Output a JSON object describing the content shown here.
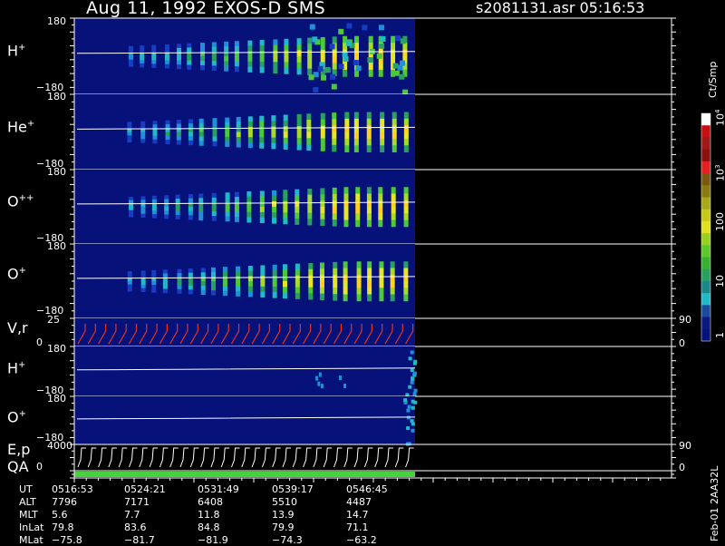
{
  "header": {
    "title": "Aug 11, 1992    EXOS-D SMS",
    "file_info": "s2081131.asr  05:16:53"
  },
  "panels": [
    {
      "label": "H",
      "sup": "+",
      "top": "180",
      "bottom": "−180"
    },
    {
      "label": "He",
      "sup": "+",
      "top": "180",
      "bottom": "−180"
    },
    {
      "label": "O",
      "sup": "++",
      "top": "180",
      "bottom": "−180"
    },
    {
      "label": "O",
      "sup": "+",
      "top": "180",
      "bottom": "−180"
    },
    {
      "label": "V,r",
      "sup": "",
      "top": "25",
      "bottom": "0",
      "right_top": "90",
      "right_bottom": "0"
    },
    {
      "label": "H",
      "sup": "+",
      "top": "180",
      "bottom": "−180"
    },
    {
      "label": "O",
      "sup": "+",
      "top": "180",
      "bottom": "−180"
    },
    {
      "label": "E,p",
      "sup": "",
      "top": "4000",
      "bottom": "0",
      "right_top": "90",
      "right_bottom": "0"
    },
    {
      "label": "QA",
      "sup": "",
      "top": "",
      "bottom": ""
    }
  ],
  "colorbar": {
    "units": "Ct/Smp",
    "labels": [
      {
        "text": "10",
        "sup": "4"
      },
      {
        "text": "10",
        "sup": "3"
      },
      {
        "text": "100",
        "sup": ""
      },
      {
        "text": "10",
        "sup": ""
      },
      {
        "text": "1",
        "sup": ""
      }
    ]
  },
  "orbit": {
    "rows": [
      {
        "name": "UT",
        "values": [
          "0516:53",
          "0524:21",
          "0531:49",
          "0539:17",
          "0546:45"
        ]
      },
      {
        "name": "ALT",
        "values": [
          "7796",
          "7171",
          "6408",
          "5510",
          "4487"
        ]
      },
      {
        "name": "MLT",
        "values": [
          "5.6",
          "7.7",
          "11.8",
          "13.9",
          "14.7"
        ]
      },
      {
        "name": "InLat",
        "values": [
          "79.8",
          "83.6",
          "84.8",
          "79.9",
          "71.1"
        ]
      },
      {
        "name": "MLat",
        "values": [
          "−75.8",
          "−81.7",
          "−81.9",
          "−74.3",
          "−63.2"
        ]
      }
    ]
  },
  "footer_id": "Feb-01 2AA32L",
  "colors": {
    "background": "#000000",
    "plot_fill": "#07117a",
    "vr_line": "#e8321e",
    "qa_bar": "#46d23c"
  }
}
